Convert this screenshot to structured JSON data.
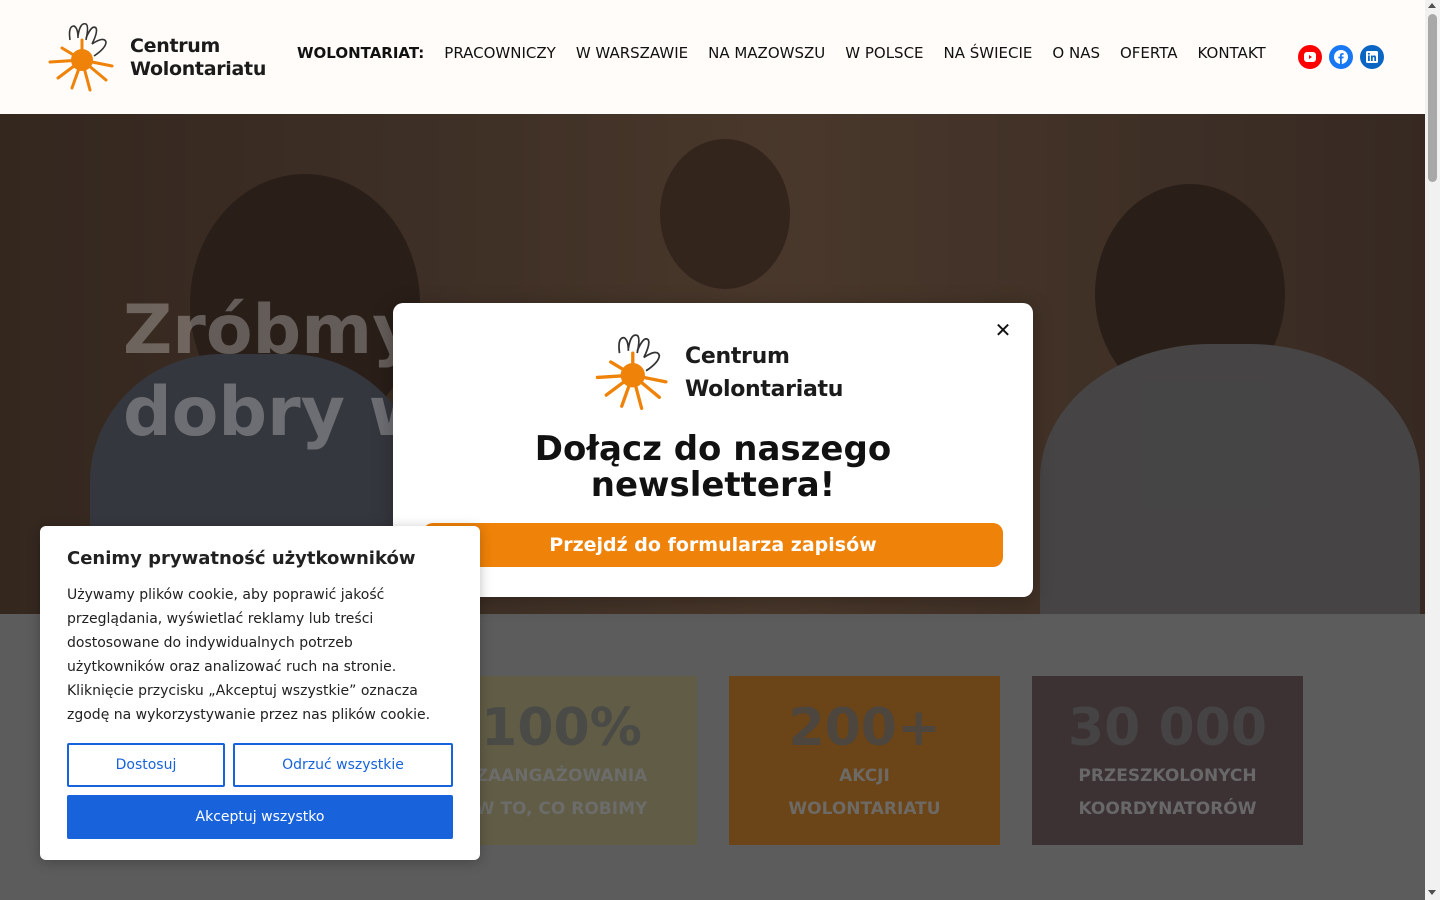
{
  "header": {
    "logo_line1": "Centrum",
    "logo_line2": "Wolontariatu",
    "nav": [
      {
        "label": "WOLONTARIAT:"
      },
      {
        "label": "PRACOWNICZY"
      },
      {
        "label": "W WARSZAWIE"
      },
      {
        "label": "NA MAZOWSZU"
      },
      {
        "label": "W POLSCE"
      },
      {
        "label": "NA ŚWIECIE"
      },
      {
        "label": "O NAS"
      },
      {
        "label": "OFERTA"
      },
      {
        "label": "KONTAKT"
      }
    ],
    "social": [
      {
        "icon": "youtube-icon",
        "color": "#ff0000"
      },
      {
        "icon": "facebook-icon",
        "color": "#1877f2"
      },
      {
        "icon": "linkedin-icon",
        "color": "#0a66c2"
      }
    ]
  },
  "hero": {
    "title_line1": "Zróbmy",
    "title_line2": "dobry w"
  },
  "stats": [
    {
      "value": "100%",
      "line1": "ZAANGAŻOWANIA",
      "line2": "W TO, CO ROBIMY",
      "color": "#6b6440"
    },
    {
      "value": "200+",
      "line1": "AKCJI",
      "line2": "WOLONTARIATU",
      "color": "#8a4f14"
    },
    {
      "value": "30 000",
      "line1": "PRZESZKOLONYCH",
      "line2": "KOORDYNATORÓW",
      "color": "#3a2b2e"
    }
  ],
  "modal": {
    "logo_line1": "Centrum",
    "logo_line2": "Wolontariatu",
    "title_line1": "Dołącz do naszego",
    "title_line2": "newslettera!",
    "button": "Przejdź do formularza zapisów",
    "close": "✕",
    "accent": "#ef8208"
  },
  "cookie": {
    "title": "Cenimy prywatność użytkowników",
    "text": "Używamy plików cookie, aby poprawić jakość przeglądania, wyświetlać reklamy lub treści dostosowane do indywidualnych potrzeb użytkowników oraz analizować ruch na stronie. Kliknięcie przycisku „Akceptuj wszystkie” oznacza zgodę na wykorzystywanie przez nas plików cookie.",
    "customize": "Dostosuj",
    "reject": "Odrzuć wszystkie",
    "accept": "Akceptuj wszystko",
    "accent": "#1863dc"
  }
}
